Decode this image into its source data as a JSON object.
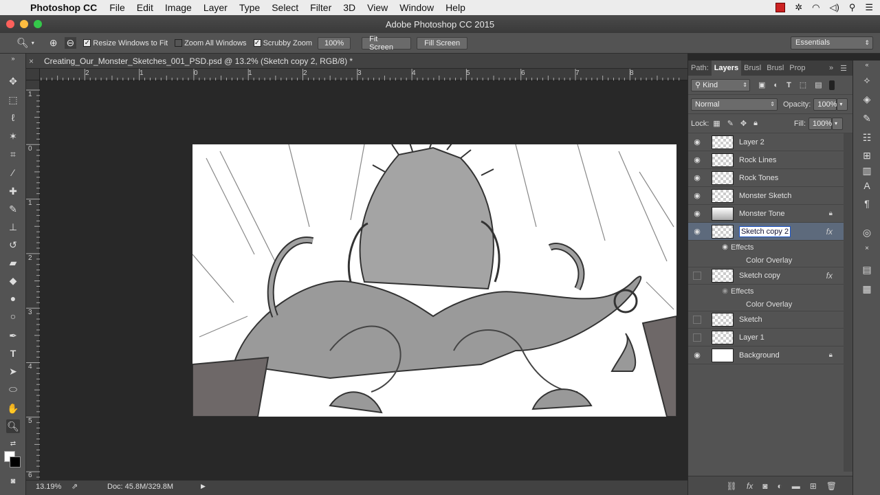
{
  "menubar": {
    "app_name": "Photoshop CC",
    "items": [
      "File",
      "Edit",
      "Image",
      "Layer",
      "Type",
      "Select",
      "Filter",
      "3D",
      "View",
      "Window",
      "Help"
    ]
  },
  "window": {
    "title": "Adobe Photoshop CC 2015"
  },
  "options": {
    "resize_windows": "Resize Windows to Fit",
    "zoom_all": "Zoom All Windows",
    "scrubby_zoom": "Scrubby Zoom",
    "zoom_value": "100%",
    "fit_screen": "Fit Screen",
    "fill_screen": "Fill Screen",
    "workspace": "Essentials"
  },
  "document": {
    "tab_title": "Creating_Our_Monster_Sketches_001_PSD.psd @ 13.2% (Sketch copy 2, RGB/8) *",
    "zoom": "13.19%",
    "doc_size": "Doc: 45.8M/329.8M"
  },
  "rulers": {
    "h_labels": [
      "2",
      "1",
      "0",
      "1",
      "2",
      "3",
      "4",
      "5",
      "6",
      "7",
      "8"
    ],
    "v_labels": [
      "1",
      "0",
      "1",
      "2",
      "3",
      "4",
      "5",
      "6"
    ]
  },
  "panel": {
    "tabs": [
      "Path:",
      "Layers",
      "Brusl",
      "Brusl",
      "Prop"
    ],
    "filter_kind": "Kind",
    "blend_mode": "Normal",
    "opacity_label": "Opacity:",
    "opacity_value": "100%",
    "lock_label": "Lock:",
    "fill_label": "Fill:",
    "fill_value": "100%"
  },
  "layers": [
    {
      "name": "Layer 2"
    },
    {
      "name": "Rock Lines"
    },
    {
      "name": "Rock Tones"
    },
    {
      "name": "Monster Sketch"
    },
    {
      "name": "Monster Tone"
    },
    {
      "name": "Sketch copy 2"
    },
    {
      "name": "Sketch copy"
    },
    {
      "name": "Sketch"
    },
    {
      "name": "Layer 1"
    },
    {
      "name": "Background"
    }
  ],
  "effects": {
    "effects_label": "Effects",
    "color_overlay": "Color Overlay"
  }
}
